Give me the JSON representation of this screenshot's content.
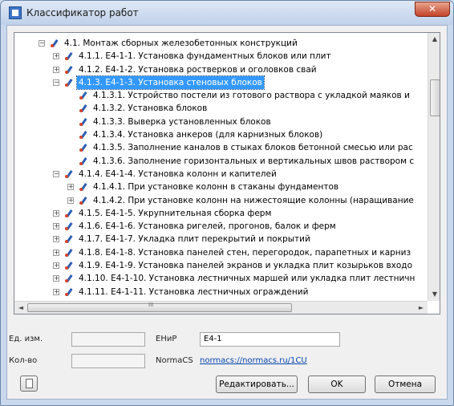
{
  "window": {
    "title": "Классификатор работ",
    "close_label": "✕"
  },
  "tree": {
    "items": [
      {
        "label": "4.1. Монтаж сборных железобетонных конструкций",
        "level": 0,
        "expander": "−"
      },
      {
        "label": "4.1.1. Е4-1-1. Установка фундаментных блоков или плит",
        "level": 1,
        "expander": "+"
      },
      {
        "label": "4.1.2. Е4-1-2. Установка ростверков и оголовков свай",
        "level": 1,
        "expander": "+"
      },
      {
        "label": "4.1.3. Е4-1-3. Установка стеновых блоков",
        "level": 1,
        "expander": "−",
        "selected": true
      },
      {
        "label": "4.1.3.1. Устройство постели из готового раствора с укладкой маяков и",
        "level": 2,
        "expander": ""
      },
      {
        "label": "4.1.3.2. Установка блоков",
        "level": 2,
        "expander": ""
      },
      {
        "label": "4.1.3.3. Выверка установленных блоков",
        "level": 2,
        "expander": ""
      },
      {
        "label": "4.1.3.4. Установка анкеров (для карнизных блоков)",
        "level": 2,
        "expander": ""
      },
      {
        "label": "4.1.3.5. Заполнение каналов в стыках блоков бетонной смесью или рас",
        "level": 2,
        "expander": ""
      },
      {
        "label": "4.1.3.6. Заполнение горизонтальных и вертикальных швов раствором с",
        "level": 2,
        "expander": ""
      },
      {
        "label": "4.1.4. Е4-1-4. Установка колонн и капителей",
        "level": 1,
        "expander": "−"
      },
      {
        "label": "4.1.4.1. При установке колонн в стаканы фундаментов",
        "level": 2,
        "expander": "+"
      },
      {
        "label": "4.1.4.2. При установке колонн на нижестоящие колонны (наращивание",
        "level": 2,
        "expander": "+"
      },
      {
        "label": "4.1.5. Е4-1-5. Укрупнительная сборка ферм",
        "level": 1,
        "expander": "+"
      },
      {
        "label": "4.1.6. Е4-1-6. Установка ригелей, прогонов, балок и ферм",
        "level": 1,
        "expander": "+"
      },
      {
        "label": "4.1.7. Е4-1-7. Укладка плит перекрытий и покрытий",
        "level": 1,
        "expander": "+"
      },
      {
        "label": "4.1.8. Е4-1-8. Установка панелей стен, перегородок, парапетных и карниз",
        "level": 1,
        "expander": "+"
      },
      {
        "label": "4.1.9. Е4-1-9. Установка панелей экранов и укладка плит козырьков входо",
        "level": 1,
        "expander": "+"
      },
      {
        "label": "4.1.10. Е4-1-10. Установка лестничных маршей или укладка плит лестничн",
        "level": 1,
        "expander": "+"
      },
      {
        "label": "4.1.11. Е4-1-11. Установка лестничных ограждений",
        "level": 1,
        "expander": "+"
      }
    ],
    "vscroll_up": "▲",
    "vscroll_down": "▼",
    "hscroll_left": "◄",
    "hscroll_right": "►",
    "hscroll_grip": "III"
  },
  "fields": {
    "unit_label": "Ед. изм.",
    "unit_value": "",
    "qty_label": "Кол-во",
    "qty_value": "",
    "enir_label": "ЕНиР",
    "enir_value": "Е4-1",
    "normacs_label": "NormaCS",
    "normacs_link": "normacs://normacs.ru/1CU"
  },
  "buttons": {
    "edit": "Редактировать...",
    "ok": "OK",
    "cancel": "Отмена"
  },
  "colors": {
    "selection": "#3399ff",
    "link": "#0645ad",
    "icon_blue": "#2f5fb3",
    "icon_red": "#d8432a"
  }
}
